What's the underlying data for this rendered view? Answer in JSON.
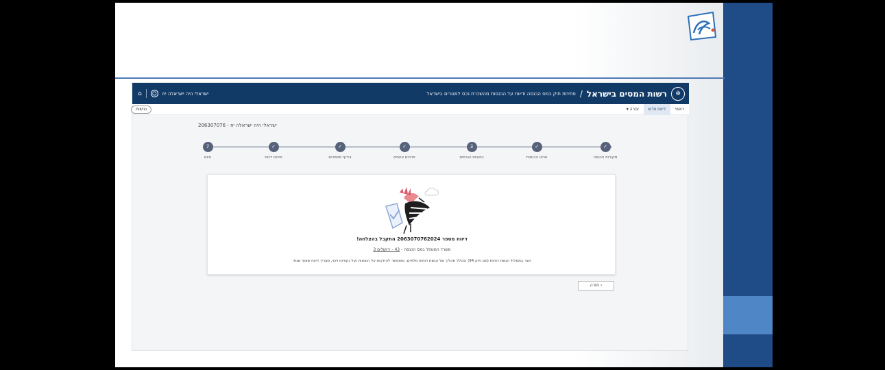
{
  "header": {
    "brand_emblem": "✲",
    "brand_title": "רשות המסים בישראל",
    "slash": "/",
    "subtitle": "פתיחת תיק במס הכנסה ודיווח על הכנסות מהשכרת נכס למגורים בישראל",
    "user_name": "ישראלי היה ישראלה יוז",
    "user_icon": "☺",
    "bell_icon": "⌂"
  },
  "nav": {
    "items": [
      {
        "label": "ראשי",
        "active": false
      },
      {
        "label": "דיווח חדש",
        "active": true
      },
      {
        "label": "עזרה ▾",
        "active": false
      }
    ],
    "accessibility": "נגישות"
  },
  "filer": "206307076 - ישראלי היה ישראלה יוז",
  "steps": [
    {
      "label": "מקורות הכנסה",
      "mark": "✓"
    },
    {
      "label": "פרוט הכנסות",
      "mark": "✓"
    },
    {
      "label": "כתובות הנכסים",
      "mark": "3"
    },
    {
      "label": "פרטים אישיים",
      "mark": "✓"
    },
    {
      "label": "צירוף מסמכים",
      "mark": "✓"
    },
    {
      "label": "סיכום דיווח",
      "mark": "✓"
    },
    {
      "label": "סיום",
      "mark": "7"
    }
  ],
  "card": {
    "report_title": "דיווח מספר 2063070762024 התקבל בהצלחה!",
    "office_prefix": "משרד המטפל במס הכנסה - ",
    "office_link": "43 - ירושלים 3",
    "note": "הצר במסלול הגשת דוחות (סוג תיק 94) הכולל תהליך של הגשת דוחות מלאים, ומאפשר להזדכות על הוצאות ועל נקודות זיכוי, מצריך דיווח שוטף שנתי"
  },
  "back_button": "‹ חזרה",
  "colors": {
    "navy": "#123a67",
    "band": "#1f4b86",
    "band_light": "#4f86c6",
    "step": "#56627a"
  }
}
